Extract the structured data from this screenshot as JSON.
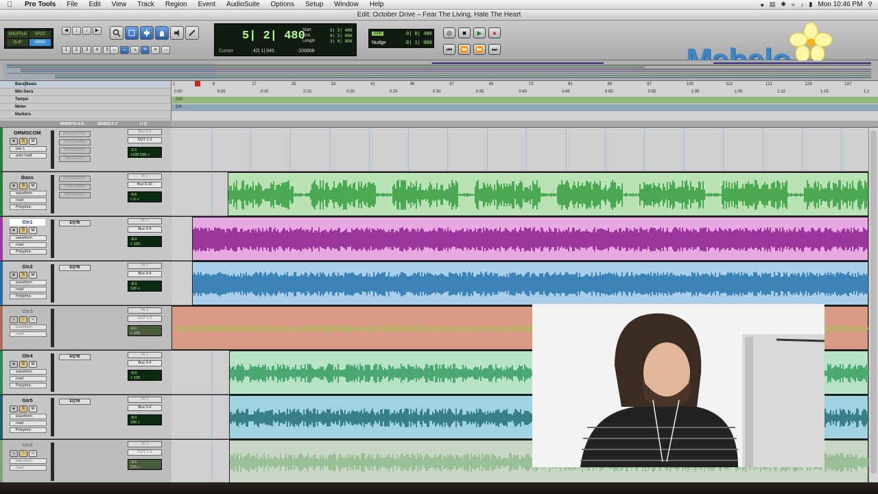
{
  "menubar": {
    "app": "Pro Tools",
    "items": [
      "File",
      "Edit",
      "View",
      "Track",
      "Region",
      "Event",
      "AudioSuite",
      "Options",
      "Setup",
      "Window",
      "Help"
    ],
    "clock": "Mon 10:46 PM"
  },
  "window_title": "Edit: October Drive – Fear The Living, Hate The Heart",
  "toolbar": {
    "modes": [
      "SHUFFLE",
      "SPOT",
      "SLIP",
      "GRID"
    ],
    "zoom_presets": [
      "1",
      "2",
      "3",
      "4",
      "5"
    ],
    "main_counter": "5| 2| 480",
    "start_label": "Start",
    "start_value": "5| 2| 480",
    "end_label": "End",
    "end_value": "8| 2| 000",
    "length_label": "Length",
    "length_value": "3| 0| 000",
    "cursor_label": "Cursor",
    "cursor_value": "42| 1| 845",
    "cursor_sample": "-106808",
    "grid_label": "Grid",
    "grid_value": "0| 0| 480",
    "nudge_label": "Nudge",
    "nudge_value": "0| 1| 000"
  },
  "logo_text": "Mahalo",
  "rulers": {
    "labels": [
      "Bars|Beats",
      "Min:Secs",
      "Tempo",
      "Meter",
      "Markers"
    ],
    "bars": [
      "1",
      "9",
      "17",
      "25",
      "33",
      "41",
      "49",
      "57",
      "65",
      "73",
      "81",
      "89",
      "97",
      "105",
      "113",
      "121",
      "129",
      "137"
    ],
    "secs": [
      "0:00",
      "0:05",
      "0:10",
      "0:15",
      "0:20",
      "0:25",
      "0:30",
      "0:35",
      "0:40",
      "0:45",
      "0:50",
      "0:55",
      "1:00",
      "1:05",
      "1:10",
      "1:15",
      "1:2"
    ],
    "tempo": "210",
    "meter": "2/4"
  },
  "columns": {
    "inserts": "INSERTS A-E",
    "sends": "SENDS F-J",
    "io": "I / O"
  },
  "tracks": [
    {
      "name": "DRMSCOM",
      "inserts": [
        "DRck6DCFG",
        "TRSCOMBG",
        "TRG3DCRG",
        "TRckCOPG"
      ],
      "io_in": "Bus 5-6",
      "io_out": "OUT 1-2",
      "vol": "-2.1",
      "pan": "+100",
      "pan2": "100 >",
      "view": "pan L",
      "mode": "auto read",
      "color": "#2f7f3a",
      "active": true
    },
    {
      "name": "Bass",
      "inserts": [
        "DRck3DCFG",
        "TRSCOMBG",
        "TRG3DCRG"
      ],
      "io_in": "IN 1",
      "io_out": "Bus 9-10",
      "vol": "-8.6",
      "pan": "< 6 >",
      "view": "waveform",
      "mode": "read",
      "plugin": "Polyphnc",
      "color": "#2f7f3a",
      "active": true
    },
    {
      "name": "Gtr1",
      "inserts": [
        "EQ7B"
      ],
      "io_in": "IN 1",
      "io_out": "Bus 3-4",
      "vol": "-8.0",
      "pan": "< 100",
      "view": "waveform",
      "mode": "read",
      "plugin": "Polyphnc",
      "color": "#9b3a9b",
      "active": true,
      "selected": true
    },
    {
      "name": "Gtr2",
      "inserts": [
        "EQ7B"
      ],
      "io_in": "IN 2",
      "io_out": "Bus 3-4",
      "vol": "-8.0",
      "pan": "100 >",
      "view": "waveform",
      "mode": "read",
      "plugin": "Polyphnc",
      "color": "#2e6aa6",
      "active": true
    },
    {
      "name": "Gtr3",
      "inserts": [],
      "io_in": "IN 3",
      "io_out": "OUT 1-2",
      "vol": "-8.0",
      "pan": "< 100",
      "view": "waveform",
      "mode": "read",
      "color": "#b06a5a",
      "active": false
    },
    {
      "name": "Gtr4",
      "inserts": [
        "EQ7B"
      ],
      "io_in": "IN 1",
      "io_out": "Bus 3-4",
      "vol": "-8.0",
      "pan": "< 100",
      "view": "waveform",
      "mode": "read",
      "plugin": "Polyphnc",
      "color": "#2f8a57",
      "active": true
    },
    {
      "name": "Gtr5",
      "inserts": [
        "EQ7B"
      ],
      "io_in": "IN 2",
      "io_out": "Bus 3-4",
      "vol": "-8.0",
      "pan": "100 >",
      "view": "waveform",
      "mode": "read",
      "plugin": "Polyphnc",
      "color": "#1f5f6a",
      "active": true
    },
    {
      "name": "Gtr6",
      "inserts": [],
      "io_in": "IN 2",
      "io_out": "OUT 1-2",
      "vol": "-8.0",
      "pan": "100 >",
      "view": "waveform",
      "mode": "read",
      "color": "#7da07a",
      "active": false
    }
  ]
}
